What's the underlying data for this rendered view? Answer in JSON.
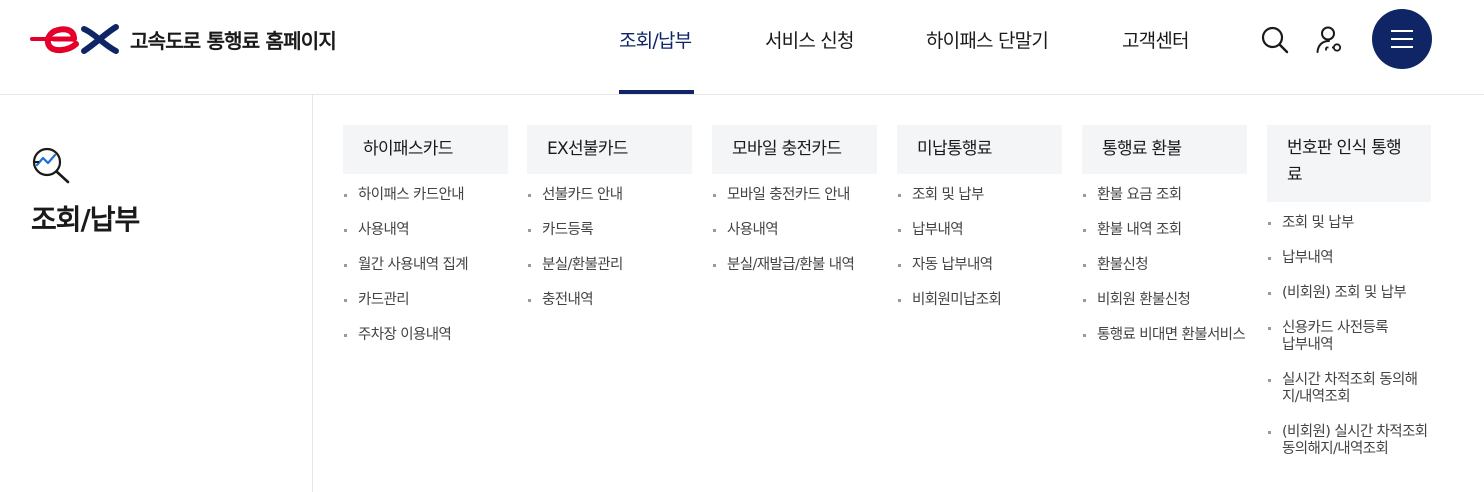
{
  "header": {
    "site_name": "고속도로 통행료 홈페이지",
    "logo_text": "ex",
    "nav": [
      {
        "label": "조회/납부",
        "active": true
      },
      {
        "label": "서비스 신청",
        "active": false
      },
      {
        "label": "하이패스 단말기",
        "active": false
      },
      {
        "label": "고객센터",
        "active": false
      }
    ],
    "utility_icons": [
      "search-icon",
      "user-icon",
      "hamburger-icon"
    ]
  },
  "section": {
    "title": "조회/납부",
    "icon": "search-chart-icon"
  },
  "columns": [
    {
      "heading": "하이패스카드",
      "items": [
        "하이패스 카드안내",
        "사용내역",
        "월간 사용내역 집계",
        "카드관리",
        "주차장 이용내역"
      ]
    },
    {
      "heading": "EX선불카드",
      "items": [
        "선불카드 안내",
        "카드등록",
        "분실/환불관리",
        "충전내역"
      ]
    },
    {
      "heading": "모바일 충전카드",
      "items": [
        "모바일 충전카드 안내",
        "사용내역",
        "분실/재발급/환불 내역"
      ]
    },
    {
      "heading": "미납통행료",
      "items": [
        "조회 및 납부",
        "납부내역",
        "자동 납부내역",
        "비회원미납조회"
      ]
    },
    {
      "heading": "통행료 환불",
      "items": [
        "환불 요금 조회",
        "환불 내역 조회",
        "환불신청",
        "비회원 환불신청",
        "통행료 비대면 환불서비스"
      ]
    },
    {
      "heading": "번호판 인식 통행료",
      "items": [
        "조회 및 납부",
        "납부내역",
        "(비회원) 조회 및 납부",
        "신용카드 사전등록 납부내역",
        "실시간 차적조회 동의해지/내역조회",
        "(비회원) 실시간 차적조회 동의해지/내역조회"
      ]
    }
  ],
  "colors": {
    "brand_navy": "#0f2566",
    "brand_red": "#e4002b",
    "menu_head_bg": "#f4f5f7"
  }
}
